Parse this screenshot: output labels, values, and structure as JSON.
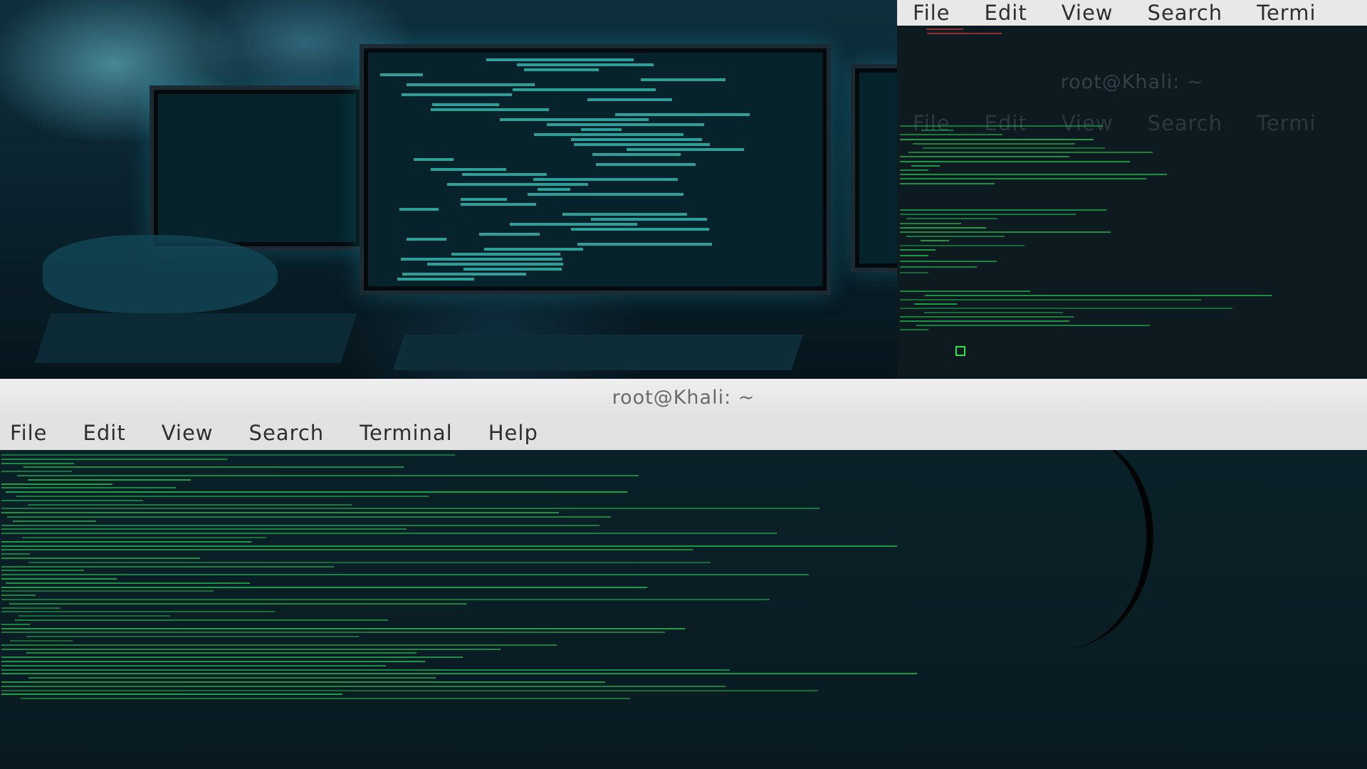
{
  "right_terminal": {
    "menu": [
      "File",
      "Edit",
      "View",
      "Search",
      "Termi"
    ],
    "ghost_title": "root@Khali: ~",
    "ghost_menu": [
      "File",
      "Edit",
      "View",
      "Search",
      "Termi"
    ]
  },
  "main_terminal": {
    "title": "root@Khali: ~",
    "menu": [
      "File",
      "Edit",
      "View",
      "Search",
      "Terminal",
      "Help"
    ]
  },
  "colors": {
    "terminal_green": "#1ea84a",
    "menubar_bg": "#e8e8e8",
    "terminal_bg": "#0a1c22"
  }
}
